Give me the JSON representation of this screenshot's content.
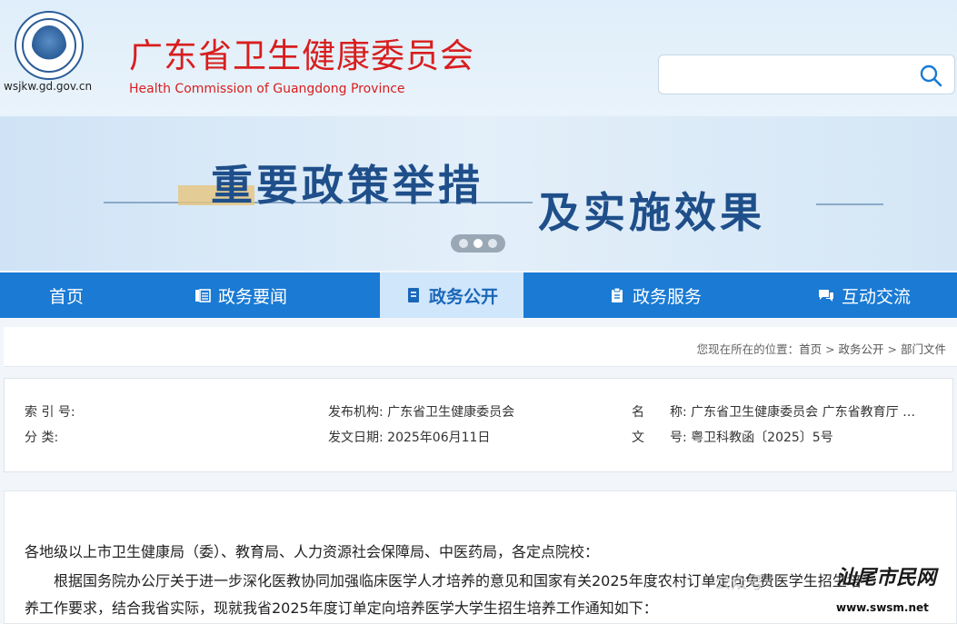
{
  "header": {
    "domain": "wsjkw.gd.gov.cn",
    "title": "广东省卫生健康委员会",
    "subtitle": "Health Commission of Guangdong Province",
    "search_placeholder": "",
    "search_value": ""
  },
  "banner": {
    "line1": "重要政策举措",
    "line2": "及实施效果",
    "slides": 3,
    "active_slide": 2
  },
  "nav": {
    "items": [
      {
        "label": "首页",
        "icon": "none"
      },
      {
        "label": "政务要闻",
        "icon": "news-icon"
      },
      {
        "label": "政务公开",
        "icon": "document-icon"
      },
      {
        "label": "政务服务",
        "icon": "clipboard-icon"
      },
      {
        "label": "互动交流",
        "icon": "chat-icon"
      }
    ],
    "active_index": 2
  },
  "breadcrumb": {
    "prefix": "您现在所在的位置：",
    "items": [
      "首页",
      "政务公开",
      "部门文件"
    ],
    "separator": " > "
  },
  "meta": {
    "index_label": "索 引 号:",
    "index_value": "",
    "category_label": "分 类:",
    "category_value": "",
    "publisher_label": "发布机构:",
    "publisher_value": "广东省卫生健康委员会",
    "date_label": "发文日期:",
    "date_value": "2025年06月11日",
    "name_label1": "名",
    "name_label2": "称:",
    "name_value": "广东省卫生健康委员会 广东省教育厅 …",
    "doc_label1": "文",
    "doc_label2": "号:",
    "doc_value": "粤卫科教函〔2025〕5号"
  },
  "content": {
    "greeting": "各地级以上市卫生健康局（委）、教育局、人力资源社会保障局、中医药局，各定点院校：",
    "para1": "根据国务院办公厅关于进一步深化医教协同加强临床医学人才培养的意见和国家有关2025年度农村订单定向免费医学生招生培",
    "para2": "养工作要求，结合我省实际，现就我省2025年度订单定向培养医学大学生招生培养工作通知如下："
  },
  "watermark": {
    "text": "公众号",
    "stamp": "汕尾市民网",
    "stamp_url": "www.swsm.net"
  },
  "colors": {
    "title_red": "#d81e1e",
    "nav_blue": "#1a7ad4",
    "nav_active_bg": "#cfe6fb",
    "banner_blue": "#1f4f8a"
  }
}
